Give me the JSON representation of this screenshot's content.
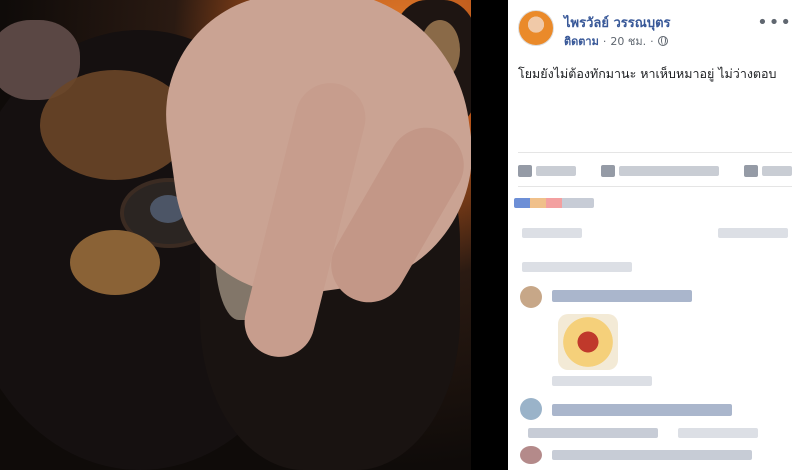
{
  "photo": {
    "alt": ""
  },
  "post": {
    "author": "ไพรวัลย์ วรรณบุตร",
    "follow_label": "ติดตาม",
    "time": "20 ชม.",
    "separator": "·",
    "privacy_icon": "globe-icon",
    "more_icon": "ellipsis-icon",
    "text": "โยมยังไม่ต้องทักมานะ หาเห็บหมาอยู่ ไม่ว่างตอบ"
  },
  "colors": {
    "link": "#385898",
    "secondary_text": "#606770",
    "panel_bg": "#ffffff",
    "backdrop": "#000000"
  }
}
